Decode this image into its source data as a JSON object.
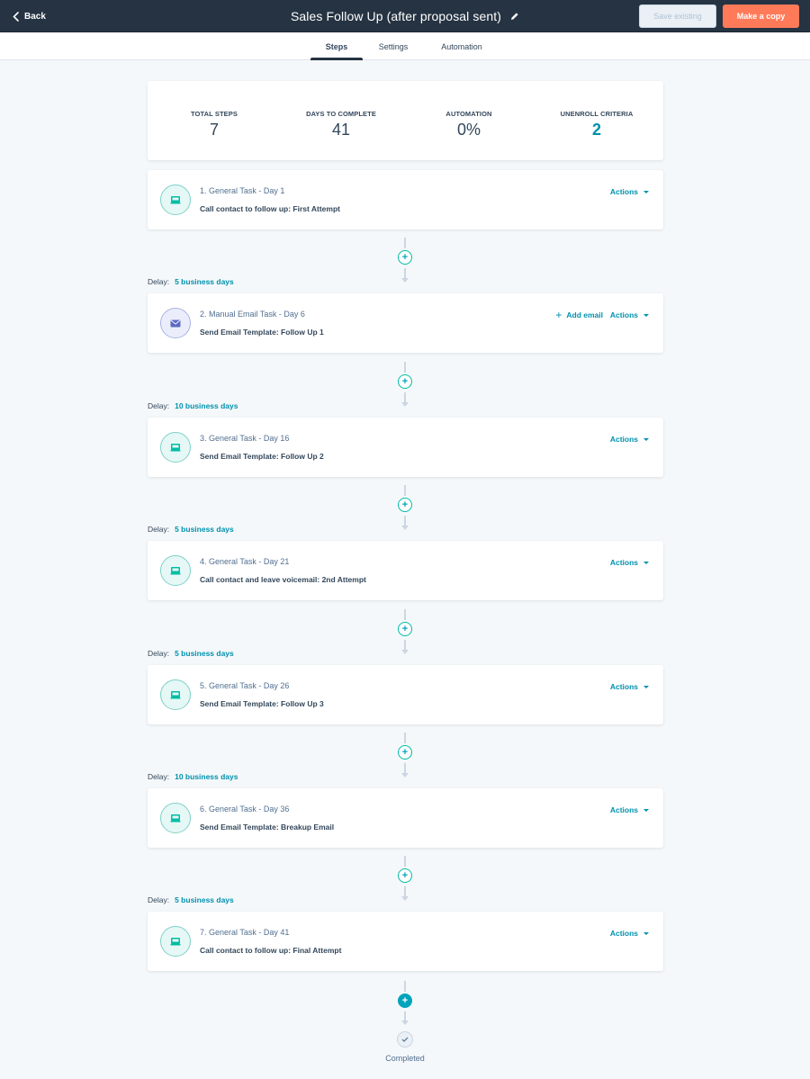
{
  "header": {
    "back_label": "Back",
    "title": "Sales Follow Up (after proposal sent)",
    "save_label": "Save existing",
    "copy_label": "Make a copy",
    "icons": {
      "back": "chevron-left-icon",
      "edit": "pencil-icon"
    }
  },
  "tabs": [
    {
      "label": "Steps",
      "active": true
    },
    {
      "label": "Settings",
      "active": false
    },
    {
      "label": "Automation",
      "active": false
    }
  ],
  "summary": {
    "stats": [
      {
        "label": "TOTAL STEPS",
        "value": "7"
      },
      {
        "label": "DAYS TO COMPLETE",
        "value": "41"
      },
      {
        "label": "AUTOMATION",
        "value": "0%"
      },
      {
        "label": "UNENROLL CRITERIA",
        "value": "2"
      }
    ]
  },
  "delay_label": "Delay:",
  "actions_label": "Actions",
  "add_email_label": "Add email",
  "steps": [
    {
      "subtitle": "1. General Task - Day 1",
      "title": "Call contact to follow up: First Attempt",
      "type": "task"
    },
    {
      "subtitle": "2. Manual Email Task - Day 6",
      "title": "Send Email Template: Follow Up 1",
      "type": "email",
      "delay": "5 business days"
    },
    {
      "subtitle": "3. General Task - Day 16",
      "title": "Send Email Template: Follow Up 2",
      "type": "task",
      "delay": "10 business days"
    },
    {
      "subtitle": "4. General Task - Day 21",
      "title": "Call contact and leave voicemail: 2nd Attempt",
      "type": "task",
      "delay": "5 business days"
    },
    {
      "subtitle": "5. General Task - Day 26",
      "title": "Send Email Template: Follow Up 3",
      "type": "task",
      "delay": "5 business days"
    },
    {
      "subtitle": "6. General Task - Day 36",
      "title": "Send Email Template: Breakup Email",
      "type": "task",
      "delay": "10 business days"
    },
    {
      "subtitle": "7. General Task - Day 41",
      "title": "Call contact to follow up: Final Attempt",
      "type": "task",
      "delay": "5 business days"
    }
  ],
  "completed_label": "Completed",
  "colors": {
    "accent": "#0091ae",
    "primary_button": "#ff7a59",
    "header_bg": "#253342",
    "task_icon": "#00bda5",
    "email_icon": "#5c6ac4"
  }
}
